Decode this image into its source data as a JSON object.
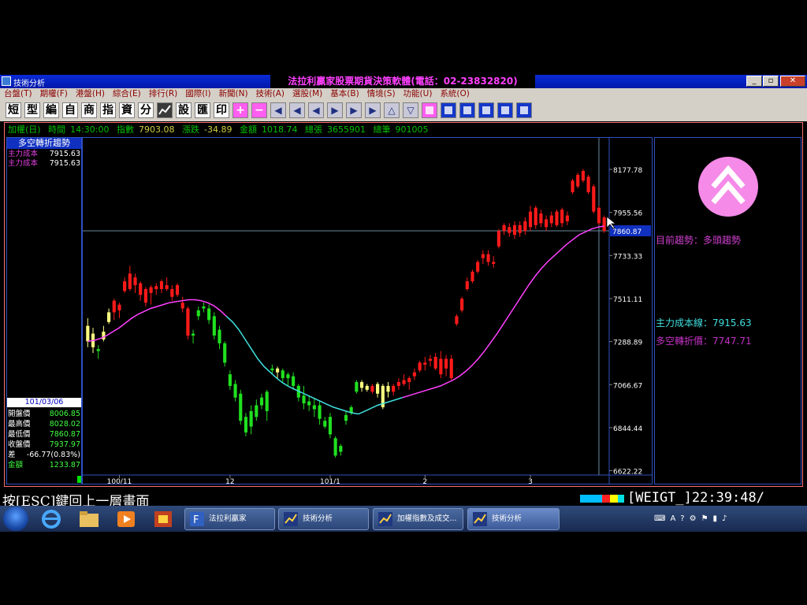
{
  "window": {
    "title": "技術分析",
    "banner": "法拉利贏家股票期貨決策軟體(電話：02-23832820)",
    "controls": {
      "minimize": "_",
      "restore": "▫",
      "close": "✕"
    }
  },
  "menu": [
    "台盤(T)",
    "期權(F)",
    "港盤(H)",
    "綜合(E)",
    "排行(R)",
    "國際(I)",
    "新聞(N)",
    "技術(A)",
    "選股(M)",
    "基本(B)",
    "情境(S)",
    "功能(U)",
    "系統(O)"
  ],
  "toolbar": {
    "text_buttons": [
      "短",
      "型",
      "編",
      "自",
      "商",
      "指",
      "資",
      "分",
      "設",
      "匯",
      "印"
    ],
    "chart_icon": "bar-chart-icon",
    "zoom_in": "+",
    "zoom_out": "−",
    "nav": [
      "◀",
      "◀",
      "◀",
      "▶",
      "▶",
      "▶",
      "△",
      "▽"
    ],
    "tail_icons": [
      "color-icon",
      "link-icon",
      "link2-icon",
      "export-icon",
      "lock-icon",
      "settings-icon"
    ]
  },
  "infobar": {
    "name": "加權(日)",
    "time_label": "時間",
    "time": "14:30:00",
    "index_label": "指數",
    "index": "7903.08",
    "change_label": "漲跌",
    "change": "-34.89",
    "amount_label": "金額",
    "amount": "1018.74",
    "volume_label": "總張",
    "volume": "3655901",
    "trades_label": "總筆",
    "trades": "901005"
  },
  "left_panel": {
    "title": "多空轉折趨勢",
    "legend": [
      {
        "label": "主力成本",
        "value": "7915.63",
        "color": "#e040e0"
      },
      {
        "label": "主力成本",
        "value": "7915.63",
        "color": "#e040e0"
      }
    ],
    "date": "101/03/06",
    "quotes": [
      {
        "label": "開盤價",
        "value": "8006.85"
      },
      {
        "label": "最高價",
        "value": "8028.02"
      },
      {
        "label": "最低價",
        "value": "7860.87"
      },
      {
        "label": "收盤價",
        "value": "7937.97"
      },
      {
        "label": "差",
        "value": "-66.77(0.83%)"
      },
      {
        "label": "金額",
        "value": "1233.87"
      }
    ]
  },
  "right_panel": {
    "trend": "目前趨勢：多頭趨勢",
    "cost_line": "主力成本線：7915.63",
    "turn_price": "多空轉折價：7747.71",
    "trend_icon": "up-chevron-icon"
  },
  "status": {
    "hint": "按[ESC]鍵回上一層畫面",
    "right": "[WEIGT_]22:39:48/",
    "colors": [
      "#00bfff",
      "#ff2020",
      "#ffff00",
      "#00e0e0"
    ]
  },
  "taskbar": {
    "pinned": [
      "ie-icon",
      "folder-icon",
      "media-player-icon",
      "app-icon"
    ],
    "tasks": [
      "法拉利贏家",
      "技術分析",
      "加權指數及成交...",
      "技術分析"
    ],
    "tray_text": "A"
  },
  "chart_data": {
    "type": "candlestick",
    "title": "多空轉折趨勢",
    "ylim": [
      6600,
      8300
    ],
    "y_ticks": [
      "8177.78",
      "7955.56",
      "7733.33",
      "7511.11",
      "7288.89",
      "7066.67",
      "6844.44",
      "6622.22"
    ],
    "x_ticks": [
      "100/11",
      "12",
      "101/1",
      "2",
      "3"
    ],
    "crosshair_price": "7860.87",
    "series": [
      {
        "name": "主力成本",
        "color": "#ff40ff"
      },
      {
        "name": "多空轉折",
        "color": "#40e0e0"
      }
    ],
    "candles": [
      {
        "o": 7290,
        "h": 7410,
        "l": 7260,
        "c": 7370,
        "col": "y"
      },
      {
        "o": 7330,
        "h": 7360,
        "l": 7230,
        "c": 7260,
        "col": "y"
      },
      {
        "o": 7250,
        "h": 7270,
        "l": 7200,
        "c": 7240,
        "col": "g"
      },
      {
        "o": 7340,
        "h": 7370,
        "l": 7290,
        "c": 7300,
        "col": "y"
      },
      {
        "o": 7390,
        "h": 7460,
        "l": 7380,
        "c": 7440,
        "col": "y"
      },
      {
        "o": 7440,
        "h": 7510,
        "l": 7400,
        "c": 7500,
        "col": "r"
      },
      {
        "o": 7450,
        "h": 7490,
        "l": 7410,
        "c": 7480,
        "col": "r"
      },
      {
        "o": 7550,
        "h": 7620,
        "l": 7540,
        "c": 7600,
        "col": "r"
      },
      {
        "o": 7560,
        "h": 7680,
        "l": 7550,
        "c": 7640,
        "col": "r"
      },
      {
        "o": 7580,
        "h": 7640,
        "l": 7540,
        "c": 7620,
        "col": "r"
      },
      {
        "o": 7530,
        "h": 7600,
        "l": 7500,
        "c": 7590,
        "col": "r"
      },
      {
        "o": 7490,
        "h": 7570,
        "l": 7470,
        "c": 7560,
        "col": "r"
      },
      {
        "o": 7540,
        "h": 7580,
        "l": 7480,
        "c": 7570,
        "col": "r"
      },
      {
        "o": 7560,
        "h": 7590,
        "l": 7530,
        "c": 7575,
        "col": "r"
      },
      {
        "o": 7560,
        "h": 7610,
        "l": 7540,
        "c": 7600,
        "col": "r"
      },
      {
        "o": 7560,
        "h": 7620,
        "l": 7550,
        "c": 7580,
        "col": "r"
      },
      {
        "o": 7520,
        "h": 7580,
        "l": 7500,
        "c": 7560,
        "col": "r"
      },
      {
        "o": 7530,
        "h": 7590,
        "l": 7520,
        "c": 7580,
        "col": "r"
      },
      {
        "o": 7490,
        "h": 7520,
        "l": 7440,
        "c": 7460,
        "col": "r"
      },
      {
        "o": 7460,
        "h": 7470,
        "l": 7300,
        "c": 7320,
        "col": "r"
      },
      {
        "o": 7320,
        "h": 7350,
        "l": 7280,
        "c": 7330,
        "col": "g"
      },
      {
        "o": 7450,
        "h": 7470,
        "l": 7400,
        "c": 7420,
        "col": "g"
      },
      {
        "o": 7460,
        "h": 7490,
        "l": 7440,
        "c": 7470,
        "col": "g"
      },
      {
        "o": 7460,
        "h": 7480,
        "l": 7380,
        "c": 7400,
        "col": "g"
      },
      {
        "o": 7420,
        "h": 7440,
        "l": 7300,
        "c": 7320,
        "col": "g"
      },
      {
        "o": 7350,
        "h": 7370,
        "l": 7250,
        "c": 7280,
        "col": "g"
      },
      {
        "o": 7280,
        "h": 7290,
        "l": 7160,
        "c": 7180,
        "col": "g"
      },
      {
        "o": 7120,
        "h": 7140,
        "l": 7040,
        "c": 7060,
        "col": "g"
      },
      {
        "o": 7070,
        "h": 7090,
        "l": 6980,
        "c": 7000,
        "col": "g"
      },
      {
        "o": 7020,
        "h": 7040,
        "l": 6860,
        "c": 6880,
        "col": "g"
      },
      {
        "o": 6900,
        "h": 6920,
        "l": 6800,
        "c": 6820,
        "col": "g"
      },
      {
        "o": 6930,
        "h": 6960,
        "l": 6810,
        "c": 6850,
        "col": "g"
      },
      {
        "o": 6960,
        "h": 6990,
        "l": 6880,
        "c": 6900,
        "col": "g"
      },
      {
        "o": 7000,
        "h": 7020,
        "l": 6940,
        "c": 6960,
        "col": "g"
      },
      {
        "o": 7030,
        "h": 7040,
        "l": 6880,
        "c": 6930,
        "col": "g"
      },
      {
        "o": 7150,
        "h": 7170,
        "l": 7120,
        "c": 7140,
        "col": "g"
      },
      {
        "o": 7130,
        "h": 7160,
        "l": 7100,
        "c": 7150,
        "col": "y"
      },
      {
        "o": 7140,
        "h": 7150,
        "l": 7080,
        "c": 7100,
        "col": "g"
      },
      {
        "o": 7120,
        "h": 7130,
        "l": 7060,
        "c": 7100,
        "col": "g"
      },
      {
        "o": 7110,
        "h": 7130,
        "l": 7040,
        "c": 7060,
        "col": "g"
      },
      {
        "o": 7060,
        "h": 7070,
        "l": 6980,
        "c": 7000,
        "col": "g"
      },
      {
        "o": 7010,
        "h": 7060,
        "l": 6940,
        "c": 6970,
        "col": "g"
      },
      {
        "o": 6980,
        "h": 7010,
        "l": 6930,
        "c": 6960,
        "col": "g"
      },
      {
        "o": 6960,
        "h": 7000,
        "l": 6900,
        "c": 6940,
        "col": "g"
      },
      {
        "o": 6960,
        "h": 6980,
        "l": 6860,
        "c": 6890,
        "col": "g"
      },
      {
        "o": 6880,
        "h": 6900,
        "l": 6840,
        "c": 6850,
        "col": "g"
      },
      {
        "o": 6900,
        "h": 6920,
        "l": 6790,
        "c": 6810,
        "col": "g"
      },
      {
        "o": 6790,
        "h": 6800,
        "l": 6690,
        "c": 6700,
        "col": "g"
      },
      {
        "o": 6750,
        "h": 6760,
        "l": 6700,
        "c": 6720,
        "col": "g"
      },
      {
        "o": 6880,
        "h": 6930,
        "l": 6860,
        "c": 6910,
        "col": "g"
      },
      {
        "o": 6920,
        "h": 6960,
        "l": 6910,
        "c": 6950,
        "col": "g"
      },
      {
        "o": 7030,
        "h": 7090,
        "l": 7020,
        "c": 7080,
        "col": "g"
      },
      {
        "o": 7050,
        "h": 7090,
        "l": 7030,
        "c": 7080,
        "col": "y"
      },
      {
        "o": 7040,
        "h": 7070,
        "l": 7030,
        "c": 7060,
        "col": "y"
      },
      {
        "o": 7030,
        "h": 7070,
        "l": 7020,
        "c": 7060,
        "col": "r"
      },
      {
        "o": 7070,
        "h": 7080,
        "l": 7000,
        "c": 7020,
        "col": "y"
      },
      {
        "o": 6950,
        "h": 7070,
        "l": 6940,
        "c": 7060,
        "col": "y"
      },
      {
        "o": 7060,
        "h": 7080,
        "l": 7000,
        "c": 7030,
        "col": "y"
      },
      {
        "o": 7030,
        "h": 7070,
        "l": 7010,
        "c": 7060,
        "col": "r"
      },
      {
        "o": 7080,
        "h": 7100,
        "l": 7040,
        "c": 7060,
        "col": "r"
      },
      {
        "o": 7090,
        "h": 7120,
        "l": 7060,
        "c": 7070,
        "col": "r"
      },
      {
        "o": 7080,
        "h": 7110,
        "l": 7040,
        "c": 7100,
        "col": "r"
      },
      {
        "o": 7110,
        "h": 7150,
        "l": 7090,
        "c": 7130,
        "col": "r"
      },
      {
        "o": 7140,
        "h": 7190,
        "l": 7130,
        "c": 7180,
        "col": "r"
      },
      {
        "o": 7180,
        "h": 7210,
        "l": 7140,
        "c": 7170,
        "col": "r"
      },
      {
        "o": 7190,
        "h": 7220,
        "l": 7160,
        "c": 7200,
        "col": "r"
      },
      {
        "o": 7150,
        "h": 7230,
        "l": 7140,
        "c": 7210,
        "col": "r"
      },
      {
        "o": 7120,
        "h": 7240,
        "l": 7100,
        "c": 7200,
        "col": "r"
      },
      {
        "o": 7150,
        "h": 7220,
        "l": 7110,
        "c": 7200,
        "col": "r"
      },
      {
        "o": 7100,
        "h": 7220,
        "l": 7090,
        "c": 7200,
        "col": "r"
      },
      {
        "o": 7380,
        "h": 7430,
        "l": 7370,
        "c": 7420,
        "col": "r"
      },
      {
        "o": 7450,
        "h": 7520,
        "l": 7440,
        "c": 7510,
        "col": "r"
      },
      {
        "o": 7560,
        "h": 7620,
        "l": 7550,
        "c": 7600,
        "col": "r"
      },
      {
        "o": 7600,
        "h": 7660,
        "l": 7590,
        "c": 7650,
        "col": "r"
      },
      {
        "o": 7650,
        "h": 7710,
        "l": 7640,
        "c": 7700,
        "col": "r"
      },
      {
        "o": 7720,
        "h": 7760,
        "l": 7690,
        "c": 7740,
        "col": "r"
      },
      {
        "o": 7740,
        "h": 7760,
        "l": 7680,
        "c": 7700,
        "col": "r"
      },
      {
        "o": 7700,
        "h": 7730,
        "l": 7670,
        "c": 7690,
        "col": "r"
      },
      {
        "o": 7780,
        "h": 7870,
        "l": 7770,
        "c": 7860,
        "col": "r"
      },
      {
        "o": 7860,
        "h": 7900,
        "l": 7840,
        "c": 7890,
        "col": "r"
      },
      {
        "o": 7850,
        "h": 7900,
        "l": 7830,
        "c": 7880,
        "col": "r"
      },
      {
        "o": 7840,
        "h": 7910,
        "l": 7820,
        "c": 7890,
        "col": "r"
      },
      {
        "o": 7850,
        "h": 7910,
        "l": 7830,
        "c": 7890,
        "col": "r"
      },
      {
        "o": 7860,
        "h": 7930,
        "l": 7840,
        "c": 7910,
        "col": "r"
      },
      {
        "o": 7880,
        "h": 7990,
        "l": 7860,
        "c": 7960,
        "col": "r"
      },
      {
        "o": 7890,
        "h": 7990,
        "l": 7870,
        "c": 7980,
        "col": "r"
      },
      {
        "o": 7900,
        "h": 7970,
        "l": 7880,
        "c": 7950,
        "col": "r"
      },
      {
        "o": 7880,
        "h": 7940,
        "l": 7860,
        "c": 7920,
        "col": "r"
      },
      {
        "o": 7900,
        "h": 7960,
        "l": 7880,
        "c": 7940,
        "col": "r"
      },
      {
        "o": 7890,
        "h": 7970,
        "l": 7880,
        "c": 7960,
        "col": "r"
      },
      {
        "o": 7900,
        "h": 7980,
        "l": 7880,
        "c": 7970,
        "col": "r"
      },
      {
        "o": 7910,
        "h": 7960,
        "l": 7890,
        "c": 7940,
        "col": "r"
      },
      {
        "o": 8060,
        "h": 8130,
        "l": 8050,
        "c": 8120,
        "col": "r"
      },
      {
        "o": 8090,
        "h": 8160,
        "l": 8080,
        "c": 8150,
        "col": "r"
      },
      {
        "o": 8120,
        "h": 8180,
        "l": 8110,
        "c": 8170,
        "col": "r"
      },
      {
        "o": 8060,
        "h": 8150,
        "l": 8050,
        "c": 8140,
        "col": "r"
      },
      {
        "o": 7960,
        "h": 8100,
        "l": 7950,
        "c": 8090,
        "col": "r"
      },
      {
        "o": 7900,
        "h": 7990,
        "l": 7890,
        "c": 7980,
        "col": "r"
      },
      {
        "o": 7860,
        "h": 7940,
        "l": 7850,
        "c": 7930,
        "col": "r"
      }
    ],
    "cost_line": [
      7290,
      7295,
      7305,
      7320,
      7340,
      7360,
      7385,
      7410,
      7430,
      7445,
      7460,
      7470,
      7480,
      7490,
      7495,
      7500,
      7505,
      7505,
      7500,
      7490,
      7475,
      7450,
      7420,
      7390,
      7350,
      7300,
      7250,
      7200,
      7160,
      7130,
      7100,
      7075,
      7055,
      7040,
      7025,
      7010,
      6995,
      6980,
      6965,
      6950,
      6940,
      6930,
      6920,
      6915,
      6930,
      6945,
      6960,
      6970,
      6980,
      6990,
      7000,
      7010,
      7020,
      7030,
      7040,
      7050,
      7060,
      7075,
      7090,
      7110,
      7135,
      7165,
      7200,
      7240,
      7285,
      7330,
      7380,
      7430,
      7480,
      7530,
      7580,
      7625,
      7665,
      7700,
      7730,
      7760,
      7790,
      7815,
      7840,
      7855,
      7870,
      7880,
      7885
    ],
    "turn_line_range": [
      22,
      50
    ]
  }
}
